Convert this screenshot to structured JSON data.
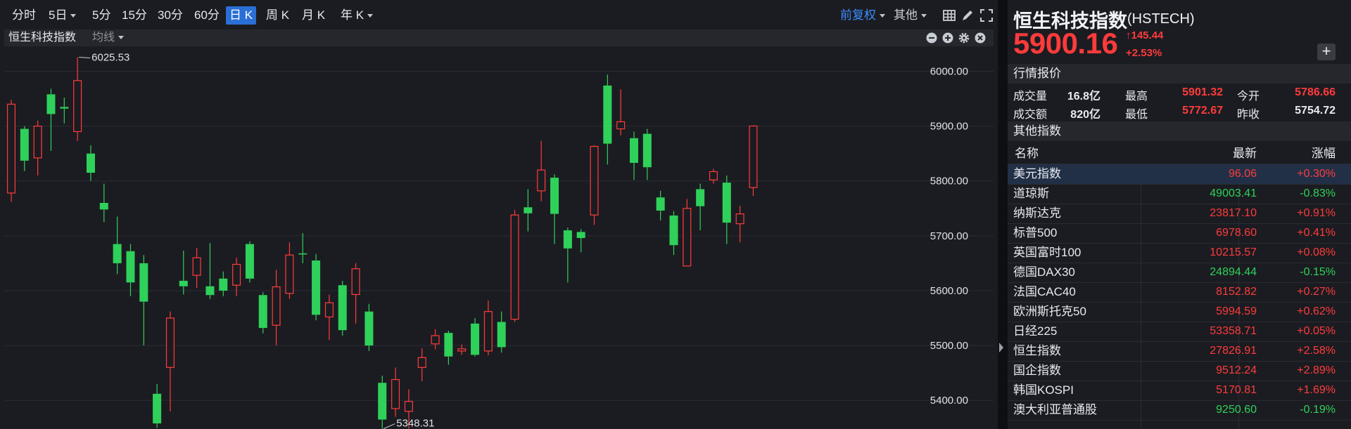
{
  "toolbar": {
    "periods": [
      {
        "label": "分时",
        "dropdown": false,
        "active": false
      },
      {
        "label": "5日",
        "dropdown": true,
        "active": false
      },
      {
        "label": "5分",
        "dropdown": false,
        "active": false
      },
      {
        "label": "15分",
        "dropdown": false,
        "active": false
      },
      {
        "label": "30分",
        "dropdown": false,
        "active": false
      },
      {
        "label": "60分",
        "dropdown": false,
        "active": false
      },
      {
        "label": "日 K",
        "dropdown": false,
        "active": true
      },
      {
        "label": "周 K",
        "dropdown": false,
        "active": false
      },
      {
        "label": "月 K",
        "dropdown": false,
        "active": false
      },
      {
        "label": "年 K",
        "dropdown": true,
        "active": false
      }
    ],
    "adjust_label": "前复权",
    "other_label": "其他",
    "accent_color": "#2a6fd6"
  },
  "subbar": {
    "indicator_name": "恒生科技指数",
    "ma_label": "均线"
  },
  "chart_data": {
    "type": "candlestick",
    "ylim": [
      5348,
      6026
    ],
    "y_ticks": [
      "6000.00",
      "5900.00",
      "5800.00",
      "5700.00",
      "5600.00",
      "5500.00",
      "5400.00"
    ],
    "y_tick_values": [
      6000,
      5900,
      5800,
      5700,
      5600,
      5500,
      5400
    ],
    "up_color": "#ff3b3b",
    "down_color": "#2fd15a",
    "annotations": [
      {
        "text": "6025.53",
        "value": 6025.53,
        "candle_index": 5
      },
      {
        "text": "5348.31",
        "value": 5348.31,
        "candle_index": 28
      }
    ],
    "candles": [
      {
        "o": 5778,
        "c": 5940,
        "h": 5948,
        "l": 5762
      },
      {
        "o": 5895,
        "c": 5837,
        "h": 5900,
        "l": 5818
      },
      {
        "o": 5842,
        "c": 5900,
        "h": 5910,
        "l": 5810
      },
      {
        "o": 5958,
        "c": 5922,
        "h": 5968,
        "l": 5855
      },
      {
        "o": 5935,
        "c": 5932,
        "h": 5952,
        "l": 5905
      },
      {
        "o": 5890,
        "c": 5983,
        "h": 6025.53,
        "l": 5873
      },
      {
        "o": 5850,
        "c": 5815,
        "h": 5865,
        "l": 5800
      },
      {
        "o": 5760,
        "c": 5748,
        "h": 5795,
        "l": 5725
      },
      {
        "o": 5685,
        "c": 5650,
        "h": 5735,
        "l": 5630
      },
      {
        "o": 5672,
        "c": 5615,
        "h": 5685,
        "l": 5590
      },
      {
        "o": 5650,
        "c": 5580,
        "h": 5665,
        "l": 5500
      },
      {
        "o": 5412,
        "c": 5358,
        "h": 5430,
        "l": 5350
      },
      {
        "o": 5460,
        "c": 5550,
        "h": 5562,
        "l": 5380
      },
      {
        "o": 5618,
        "c": 5608,
        "h": 5673,
        "l": 5593
      },
      {
        "o": 5628,
        "c": 5660,
        "h": 5678,
        "l": 5605
      },
      {
        "o": 5608,
        "c": 5592,
        "h": 5687,
        "l": 5585
      },
      {
        "o": 5622,
        "c": 5600,
        "h": 5635,
        "l": 5590
      },
      {
        "o": 5610,
        "c": 5648,
        "h": 5660,
        "l": 5590
      },
      {
        "o": 5685,
        "c": 5622,
        "h": 5690,
        "l": 5615
      },
      {
        "o": 5592,
        "c": 5532,
        "h": 5597,
        "l": 5522
      },
      {
        "o": 5537,
        "c": 5607,
        "h": 5638,
        "l": 5500
      },
      {
        "o": 5595,
        "c": 5665,
        "h": 5688,
        "l": 5585
      },
      {
        "o": 5668,
        "c": 5666,
        "h": 5705,
        "l": 5650
      },
      {
        "o": 5655,
        "c": 5556,
        "h": 5667,
        "l": 5546
      },
      {
        "o": 5552,
        "c": 5578,
        "h": 5593,
        "l": 5510
      },
      {
        "o": 5610,
        "c": 5528,
        "h": 5618,
        "l": 5518
      },
      {
        "o": 5593,
        "c": 5640,
        "h": 5650,
        "l": 5540
      },
      {
        "o": 5562,
        "c": 5500,
        "h": 5576,
        "l": 5490
      },
      {
        "o": 5432,
        "c": 5365,
        "h": 5445,
        "l": 5348.31
      },
      {
        "o": 5385,
        "c": 5438,
        "h": 5460,
        "l": 5370
      },
      {
        "o": 5380,
        "c": 5398,
        "h": 5420,
        "l": 5348.5
      },
      {
        "o": 5460,
        "c": 5478,
        "h": 5495,
        "l": 5435
      },
      {
        "o": 5503,
        "c": 5518,
        "h": 5530,
        "l": 5493
      },
      {
        "o": 5523,
        "c": 5480,
        "h": 5527,
        "l": 5465
      },
      {
        "o": 5490,
        "c": 5494,
        "h": 5502,
        "l": 5483
      },
      {
        "o": 5540,
        "c": 5483,
        "h": 5550,
        "l": 5480
      },
      {
        "o": 5490,
        "c": 5562,
        "h": 5582,
        "l": 5482
      },
      {
        "o": 5543,
        "c": 5497,
        "h": 5562,
        "l": 5487
      },
      {
        "o": 5548,
        "c": 5738,
        "h": 5747,
        "l": 5543
      },
      {
        "o": 5752,
        "c": 5741,
        "h": 5785,
        "l": 5708
      },
      {
        "o": 5782,
        "c": 5820,
        "h": 5873,
        "l": 5763
      },
      {
        "o": 5806,
        "c": 5740,
        "h": 5812,
        "l": 5685
      },
      {
        "o": 5710,
        "c": 5677,
        "h": 5715,
        "l": 5615
      },
      {
        "o": 5707,
        "c": 5696,
        "h": 5712,
        "l": 5670
      },
      {
        "o": 5738,
        "c": 5863,
        "h": 5865,
        "l": 5720
      },
      {
        "o": 5974,
        "c": 5868,
        "h": 5994,
        "l": 5830
      },
      {
        "o": 5895,
        "c": 5908,
        "h": 5967,
        "l": 5883
      },
      {
        "o": 5878,
        "c": 5833,
        "h": 5890,
        "l": 5802
      },
      {
        "o": 5886,
        "c": 5825,
        "h": 5895,
        "l": 5802
      },
      {
        "o": 5770,
        "c": 5746,
        "h": 5782,
        "l": 5728
      },
      {
        "o": 5737,
        "c": 5683,
        "h": 5745,
        "l": 5665
      },
      {
        "o": 5645,
        "c": 5750,
        "h": 5767,
        "l": 5645
      },
      {
        "o": 5785,
        "c": 5754,
        "h": 5795,
        "l": 5710
      },
      {
        "o": 5802,
        "c": 5817,
        "h": 5822,
        "l": 5795
      },
      {
        "o": 5797,
        "c": 5724,
        "h": 5810,
        "l": 5685
      },
      {
        "o": 5722,
        "c": 5740,
        "h": 5755,
        "l": 5688
      },
      {
        "o": 5788,
        "c": 5900.16,
        "h": 5901.32,
        "l": 5772.67
      }
    ]
  },
  "quote": {
    "title": "恒生科技指数",
    "code": "(HSTECH)",
    "price": "5900.16",
    "change": "145.44",
    "change_pct": "+2.53%",
    "change_arrow": "↑",
    "add_label": "+",
    "market_section": "行情报价",
    "volume_label": "成交量",
    "volume": "16.8亿",
    "turnover_label": "成交额",
    "turnover": "820亿",
    "high_label": "最高",
    "high": "5901.32",
    "low_label": "最低",
    "low": "5772.67",
    "open_label": "今开",
    "open": "5786.66",
    "prev_close_label": "昨收",
    "prev_close": "5754.72"
  },
  "others": {
    "section_title": "其他指数",
    "headers": {
      "name": "名称",
      "latest": "最新",
      "change": "涨幅"
    },
    "rows": [
      {
        "name": "美元指数",
        "price": "96.06",
        "pct": "+0.30%",
        "dir": "up",
        "selected": true
      },
      {
        "name": "道琼斯",
        "price": "49003.41",
        "pct": "-0.83%",
        "dir": "down",
        "selected": false
      },
      {
        "name": "纳斯达克",
        "price": "23817.10",
        "pct": "+0.91%",
        "dir": "up",
        "selected": false
      },
      {
        "name": "标普500",
        "price": "6978.60",
        "pct": "+0.41%",
        "dir": "up",
        "selected": false
      },
      {
        "name": "英国富时100",
        "price": "10215.57",
        "pct": "+0.08%",
        "dir": "up",
        "selected": false
      },
      {
        "name": "德国DAX30",
        "price": "24894.44",
        "pct": "-0.15%",
        "dir": "down",
        "selected": false
      },
      {
        "name": "法国CAC40",
        "price": "8152.82",
        "pct": "+0.27%",
        "dir": "up",
        "selected": false
      },
      {
        "name": "欧洲斯托克50",
        "price": "5994.59",
        "pct": "+0.62%",
        "dir": "up",
        "selected": false
      },
      {
        "name": "日经225",
        "price": "53358.71",
        "pct": "+0.05%",
        "dir": "up",
        "selected": false
      },
      {
        "name": "恒生指数",
        "price": "27826.91",
        "pct": "+2.58%",
        "dir": "up",
        "selected": false
      },
      {
        "name": "国企指数",
        "price": "9512.24",
        "pct": "+2.89%",
        "dir": "up",
        "selected": false
      },
      {
        "name": "韩国KOSPI",
        "price": "5170.81",
        "pct": "+1.69%",
        "dir": "up",
        "selected": false
      },
      {
        "name": "澳大利亚普通股",
        "price": "9250.60",
        "pct": "-0.19%",
        "dir": "down",
        "selected": false
      }
    ]
  }
}
